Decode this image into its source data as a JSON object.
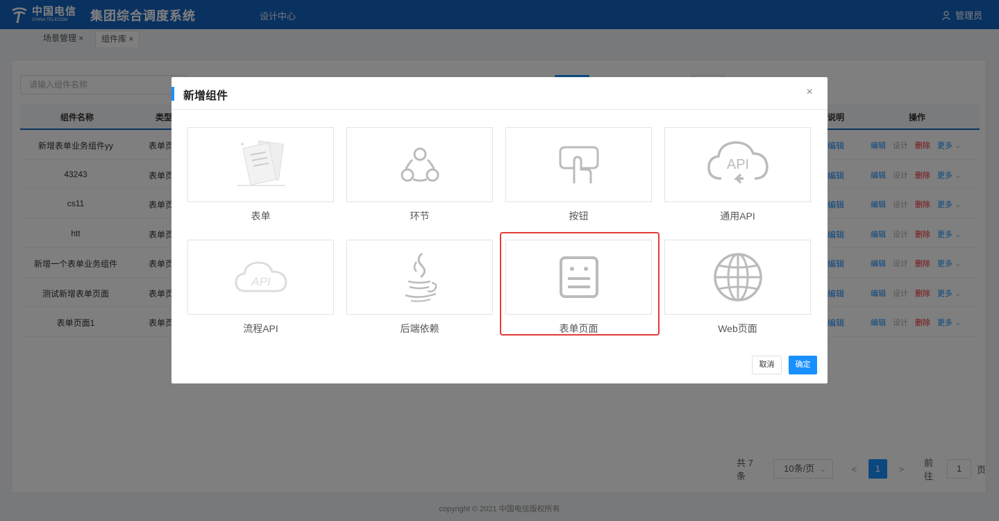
{
  "header": {
    "logo_cn": "中国电信",
    "logo_en": "CHINA TELECOM",
    "system_title": "集团综合调度系统",
    "nav_design_center": "设计中心",
    "user_name": "管理员"
  },
  "tabs": [
    {
      "label": "场景管理 ×"
    },
    {
      "label": "组件库 ×"
    }
  ],
  "search": {
    "placeholder": "请输入组件名称"
  },
  "table": {
    "headers": {
      "name": "组件名称",
      "type": "类型",
      "desc": "说明",
      "ops": "操作"
    },
    "rows": [
      {
        "name": "新增表单业务组件yy",
        "type": "表单页",
        "link": "编辑"
      },
      {
        "name": "43243",
        "type": "表单页",
        "link": "编辑"
      },
      {
        "name": "cs11",
        "type": "表单页",
        "link": "编辑"
      },
      {
        "name": "htt",
        "type": "表单页",
        "link": "编辑"
      },
      {
        "name": "新增一个表单业务组件",
        "type": "表单页",
        "link": "编辑"
      },
      {
        "name": "测试新增表单页面",
        "type": "表单页",
        "link": "编辑"
      },
      {
        "name": "表单页面1",
        "type": "表单页",
        "link": "编辑"
      }
    ],
    "ops": {
      "edit": "编辑",
      "design": "设计",
      "delete": "删除",
      "more": "更多"
    }
  },
  "pager": {
    "total": "共 7 条",
    "page_size": "10条/页",
    "prev": "<",
    "current_page": "1",
    "next": ">",
    "goto_label": "前往",
    "goto_value": "1",
    "page_suffix": "页"
  },
  "footer": {
    "copyright": "copyright © 2021 中国电信版权所有"
  },
  "dialog": {
    "title": "新增组件",
    "close": "×",
    "components": [
      {
        "label": "表单",
        "icon": "form-document-icon"
      },
      {
        "label": "环节",
        "icon": "node-link-icon"
      },
      {
        "label": "按钮",
        "icon": "touch-button-icon"
      },
      {
        "label": "通用API",
        "icon": "api-cloud-icon"
      },
      {
        "label": "流程API",
        "icon": "api-cloud-icon"
      },
      {
        "label": "后端依赖",
        "icon": "java-cup-icon"
      },
      {
        "label": "表单页面",
        "icon": "form-page-icon"
      },
      {
        "label": "Web页面",
        "icon": "globe-icon"
      }
    ],
    "api_text": "API",
    "selected": "表单页面",
    "cancel": "取消",
    "confirm": "确定"
  },
  "colors": {
    "header": "#1565c0",
    "primary": "#1890ff",
    "danger": "#f5222d",
    "highlight": "#e53935"
  }
}
